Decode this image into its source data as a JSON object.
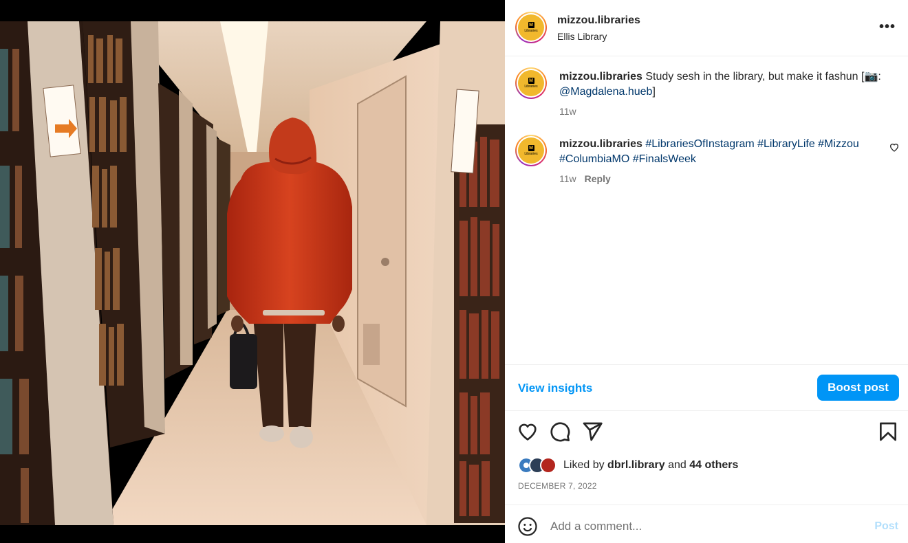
{
  "post": {
    "username": "mizzou.libraries",
    "location": "Ellis Library",
    "more_icon": "more-horizontal-icon",
    "avatar_logo": {
      "mark": "M",
      "text": "Libraries"
    }
  },
  "caption": {
    "username": "mizzou.libraries",
    "text": "Study sesh in the library, but make it fashun [",
    "camera_icon": "📷",
    "colon": ":",
    "mention": "@Magdalena.hueb",
    "close": "]",
    "time": "11w"
  },
  "comment": {
    "username": "mizzou.libraries",
    "hashtags": "#LibrariesOfInstagram #LibraryLife #Mizzou #ColumbiaMO #FinalsWeek",
    "time": "11w",
    "reply_label": "Reply"
  },
  "insights": {
    "view_label": "View insights",
    "boost_label": "Boost post"
  },
  "likes": {
    "prefix": "Liked by",
    "user": "dbrl.library",
    "and": "and",
    "others": "44 others"
  },
  "date": "DECEMBER 7, 2022",
  "add_comment": {
    "placeholder": "Add a comment...",
    "post_label": "Post"
  },
  "colors": {
    "accent": "#0095f6",
    "link": "#00376b",
    "muted": "#737373",
    "jacket": "#c8321c",
    "avatar_gold": "#f1b82d"
  }
}
